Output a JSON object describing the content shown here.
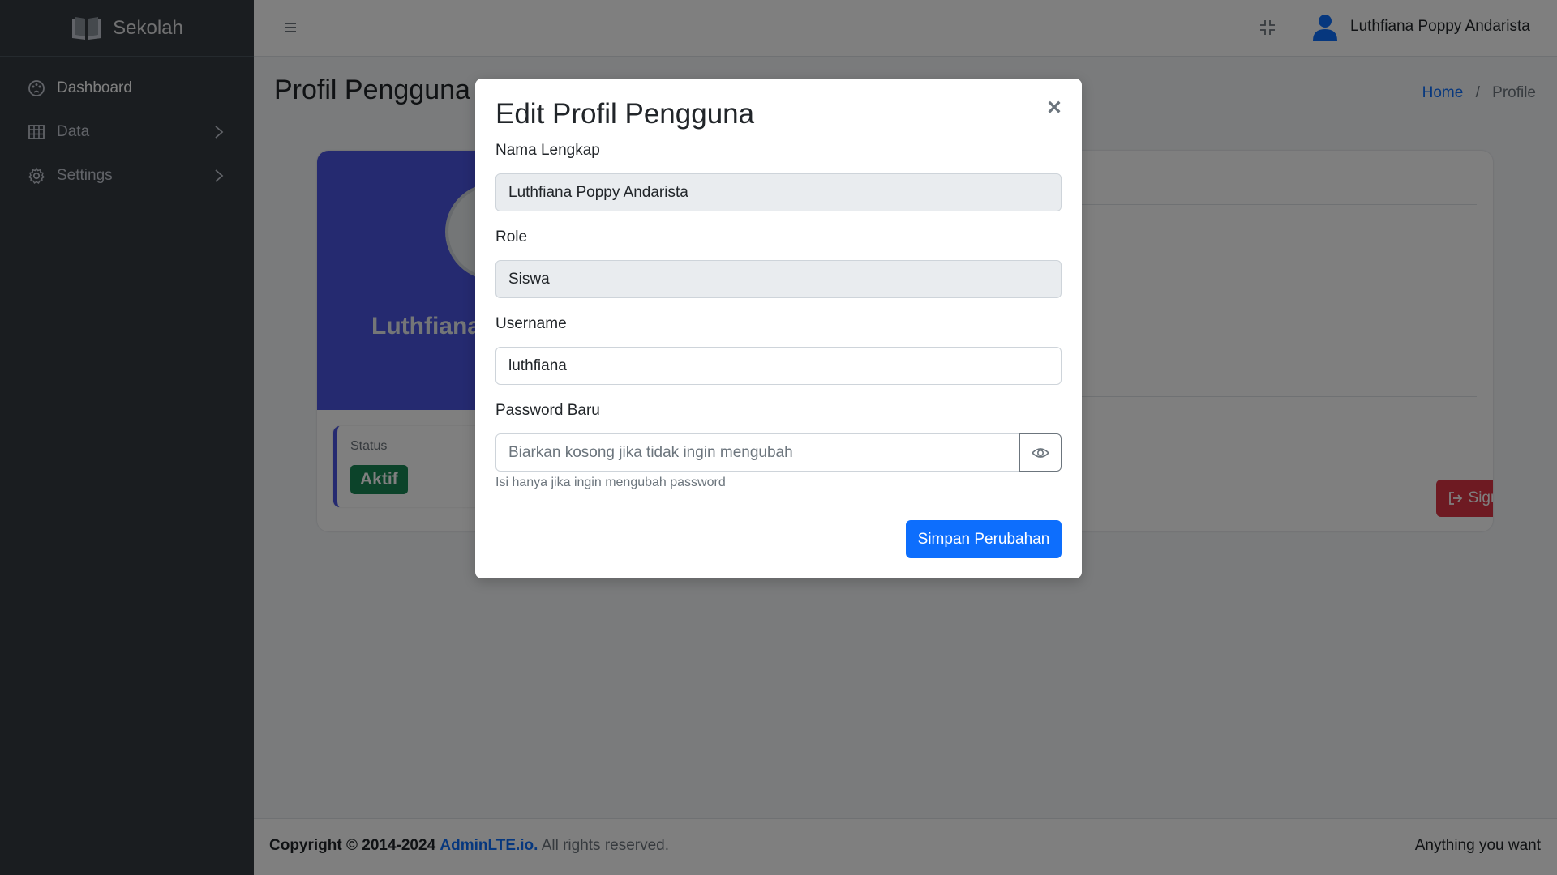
{
  "brand": {
    "name": "Sekolah",
    "icon": "book-open-icon"
  },
  "sidebar": {
    "items": [
      {
        "label": "Dashboard",
        "icon": "palette-icon",
        "active": true,
        "has_children": false
      },
      {
        "label": "Data",
        "icon": "table-icon",
        "active": false,
        "has_children": true
      },
      {
        "label": "Settings",
        "icon": "gear-icon",
        "active": false,
        "has_children": true
      }
    ]
  },
  "header": {
    "user_name": "Luthfiana Poppy Andarista",
    "icons": [
      "hamburger-icon",
      "fullscreen-exit-icon",
      "user-avatar-icon"
    ]
  },
  "page": {
    "title": "Profil Pengguna",
    "breadcrumb": {
      "home": "Home",
      "separator": "/",
      "current": "Profile"
    }
  },
  "profile": {
    "name": "Luthfiana",
    "status_label": "Status",
    "status_value": "Aktif",
    "signout_label": "Sign Out"
  },
  "modal": {
    "title": "Edit Profil Pengguna",
    "close_symbol": "×",
    "fields": {
      "nama_lengkap": {
        "label": "Nama Lengkap",
        "value": "Luthfiana Poppy Andarista"
      },
      "role": {
        "label": "Role",
        "value": "Siswa"
      },
      "username": {
        "label": "Username",
        "value": "luthfiana"
      },
      "password": {
        "label": "Password Baru",
        "value": "",
        "placeholder": "Biarkan kosong jika tidak ingin mengubah",
        "help": "Isi hanya jika ingin mengubah password"
      }
    },
    "save_label": "Simpan Perubahan"
  },
  "footer": {
    "copyright": "Copyright © 2014-2024",
    "link": "AdminLTE.io.",
    "rights": "All rights reserved.",
    "right_text": "Anything you want"
  },
  "colors": {
    "sidebar_bg": "#343a40",
    "primary": "#0d6efd",
    "danger": "#dc3545",
    "success": "#198754",
    "hero": "#4b55e0"
  }
}
